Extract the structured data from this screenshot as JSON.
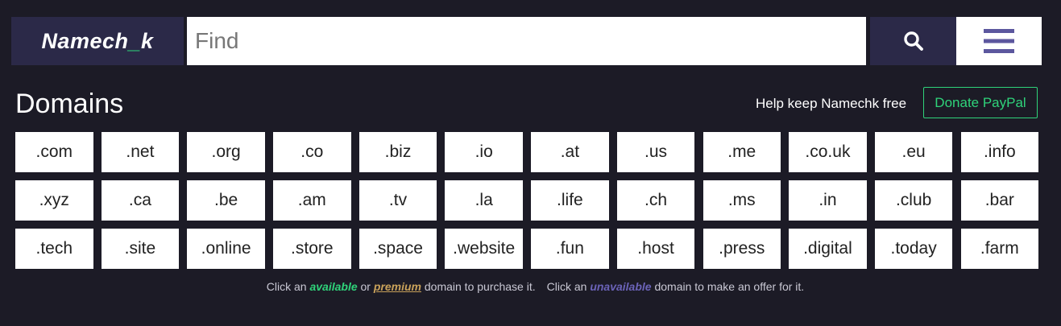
{
  "header": {
    "logo_part1": "Namech",
    "logo_accent": "_",
    "logo_part2": "k",
    "search_placeholder": "Find",
    "search_icon": "search-icon",
    "menu_icon": "hamburger-menu-icon"
  },
  "main": {
    "title": "Domains",
    "help_text": "Help keep Namechk free",
    "donate_label": "Donate PayPal"
  },
  "domains": [
    ".com",
    ".net",
    ".org",
    ".co",
    ".biz",
    ".io",
    ".at",
    ".us",
    ".me",
    ".co.uk",
    ".eu",
    ".info",
    ".xyz",
    ".ca",
    ".be",
    ".am",
    ".tv",
    ".la",
    ".life",
    ".ch",
    ".ms",
    ".in",
    ".club",
    ".bar",
    ".tech",
    ".site",
    ".online",
    ".store",
    ".space",
    ".website",
    ".fun",
    ".host",
    ".press",
    ".digital",
    ".today",
    ".farm"
  ],
  "footer_note": {
    "p1": "Click an ",
    "available": "available",
    "p2": " or ",
    "premium": "premium",
    "p3": " domain to purchase it.",
    "p4": "Click an ",
    "unavailable": "unavailable",
    "p5": " domain to make an offer for it."
  },
  "colors": {
    "background": "#1c1b26",
    "brand_dark": "#2b2948",
    "accent_green": "#2fd37a",
    "premium_gold": "#c9a25a",
    "unavailable_purple": "#6b63b8"
  }
}
